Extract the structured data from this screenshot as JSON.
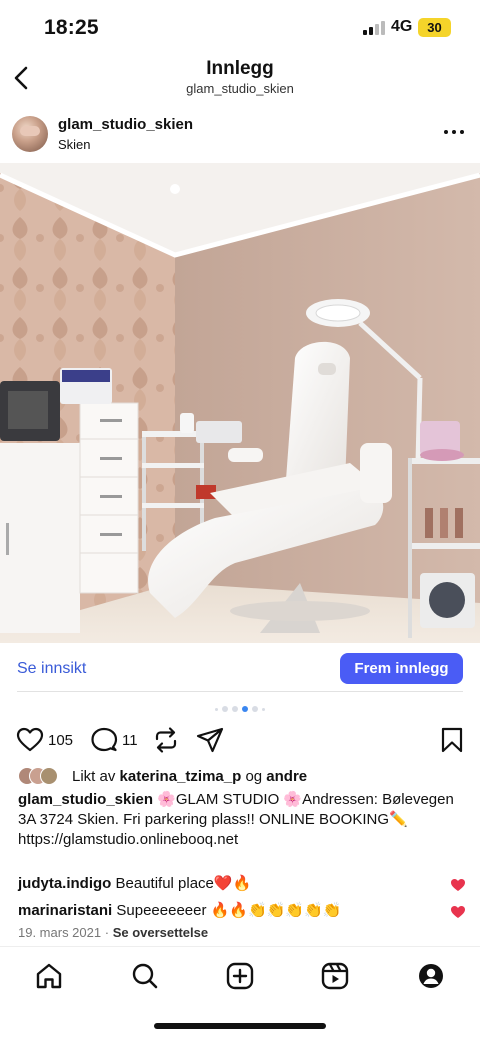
{
  "status_bar": {
    "time": "18:25",
    "network": "4G",
    "battery": "30"
  },
  "nav": {
    "title": "Innlegg",
    "subtitle": "glam_studio_skien"
  },
  "post": {
    "username": "glam_studio_skien",
    "location": "Skien",
    "image_description": "beauty salon treatment room with white chair",
    "carousel": {
      "total": 6,
      "active": 3
    }
  },
  "insights": {
    "link": "Se innsikt",
    "promote": "Frem innlegg"
  },
  "actions": {
    "likes_count": "105",
    "comments_count": "11"
  },
  "likes": {
    "prefix": "Likt av",
    "user": "katerina_tzima_p",
    "joiner": "og",
    "others": "andre"
  },
  "caption": {
    "username": "glam_studio_skien",
    "text": " 🌸GLAM STUDIO 🌸Andressen: Bølevegen 3A 3724 Skien. Fri parkering plass!! ONLINE BOOKING✏️",
    "link": "https://glamstudio.onlinebooq.net"
  },
  "comments": [
    {
      "username": "judyta.indigo",
      "text": "Beautiful place❤️🔥"
    },
    {
      "username": "marinaristani",
      "text": "Supeeeeeeer 🔥🔥👏👏👏👏👏"
    }
  ],
  "meta": {
    "date": "19. mars 2021",
    "separator": "·",
    "translate": "Se oversettelse"
  },
  "colors": {
    "accent": "#4a5cf5",
    "link": "#3a5bd8",
    "heart": "#e8344e",
    "battery": "#f5d42a"
  },
  "icons": [
    "back-icon",
    "more-icon",
    "heart-icon",
    "comment-icon",
    "repost-icon",
    "share-icon",
    "bookmark-icon",
    "home-icon",
    "search-icon",
    "create-icon",
    "reels-icon",
    "profile-icon"
  ]
}
